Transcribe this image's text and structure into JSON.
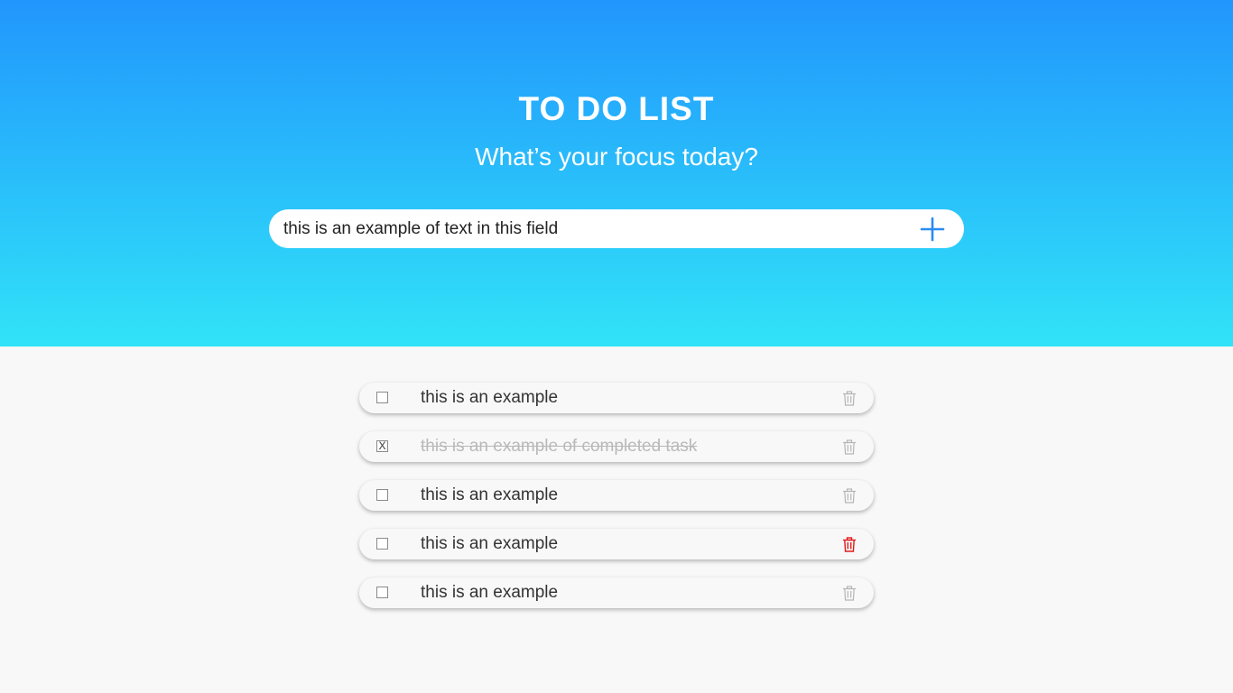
{
  "header": {
    "title": "TO DO LIST",
    "subtitle": "What’s your focus today?"
  },
  "input": {
    "value": "this is an example of text in this field",
    "add_icon": "plus-icon"
  },
  "colors": {
    "gradient_top": "#2196fd",
    "gradient_bottom": "#31e3f8",
    "accent": "#2a8bf2",
    "trash_default": "#b5b5b5",
    "trash_hover": "#e01b1b"
  },
  "tasks": [
    {
      "text": "this is an example",
      "completed": false,
      "check_mark": ""
    },
    {
      "text": "this is an example of completed task",
      "completed": true,
      "check_mark": "X"
    },
    {
      "text": "this is an example",
      "completed": false,
      "check_mark": ""
    },
    {
      "text": "this is an example",
      "completed": false,
      "check_mark": "",
      "trash_highlighted": true
    },
    {
      "text": "this is an example",
      "completed": false,
      "check_mark": ""
    }
  ]
}
